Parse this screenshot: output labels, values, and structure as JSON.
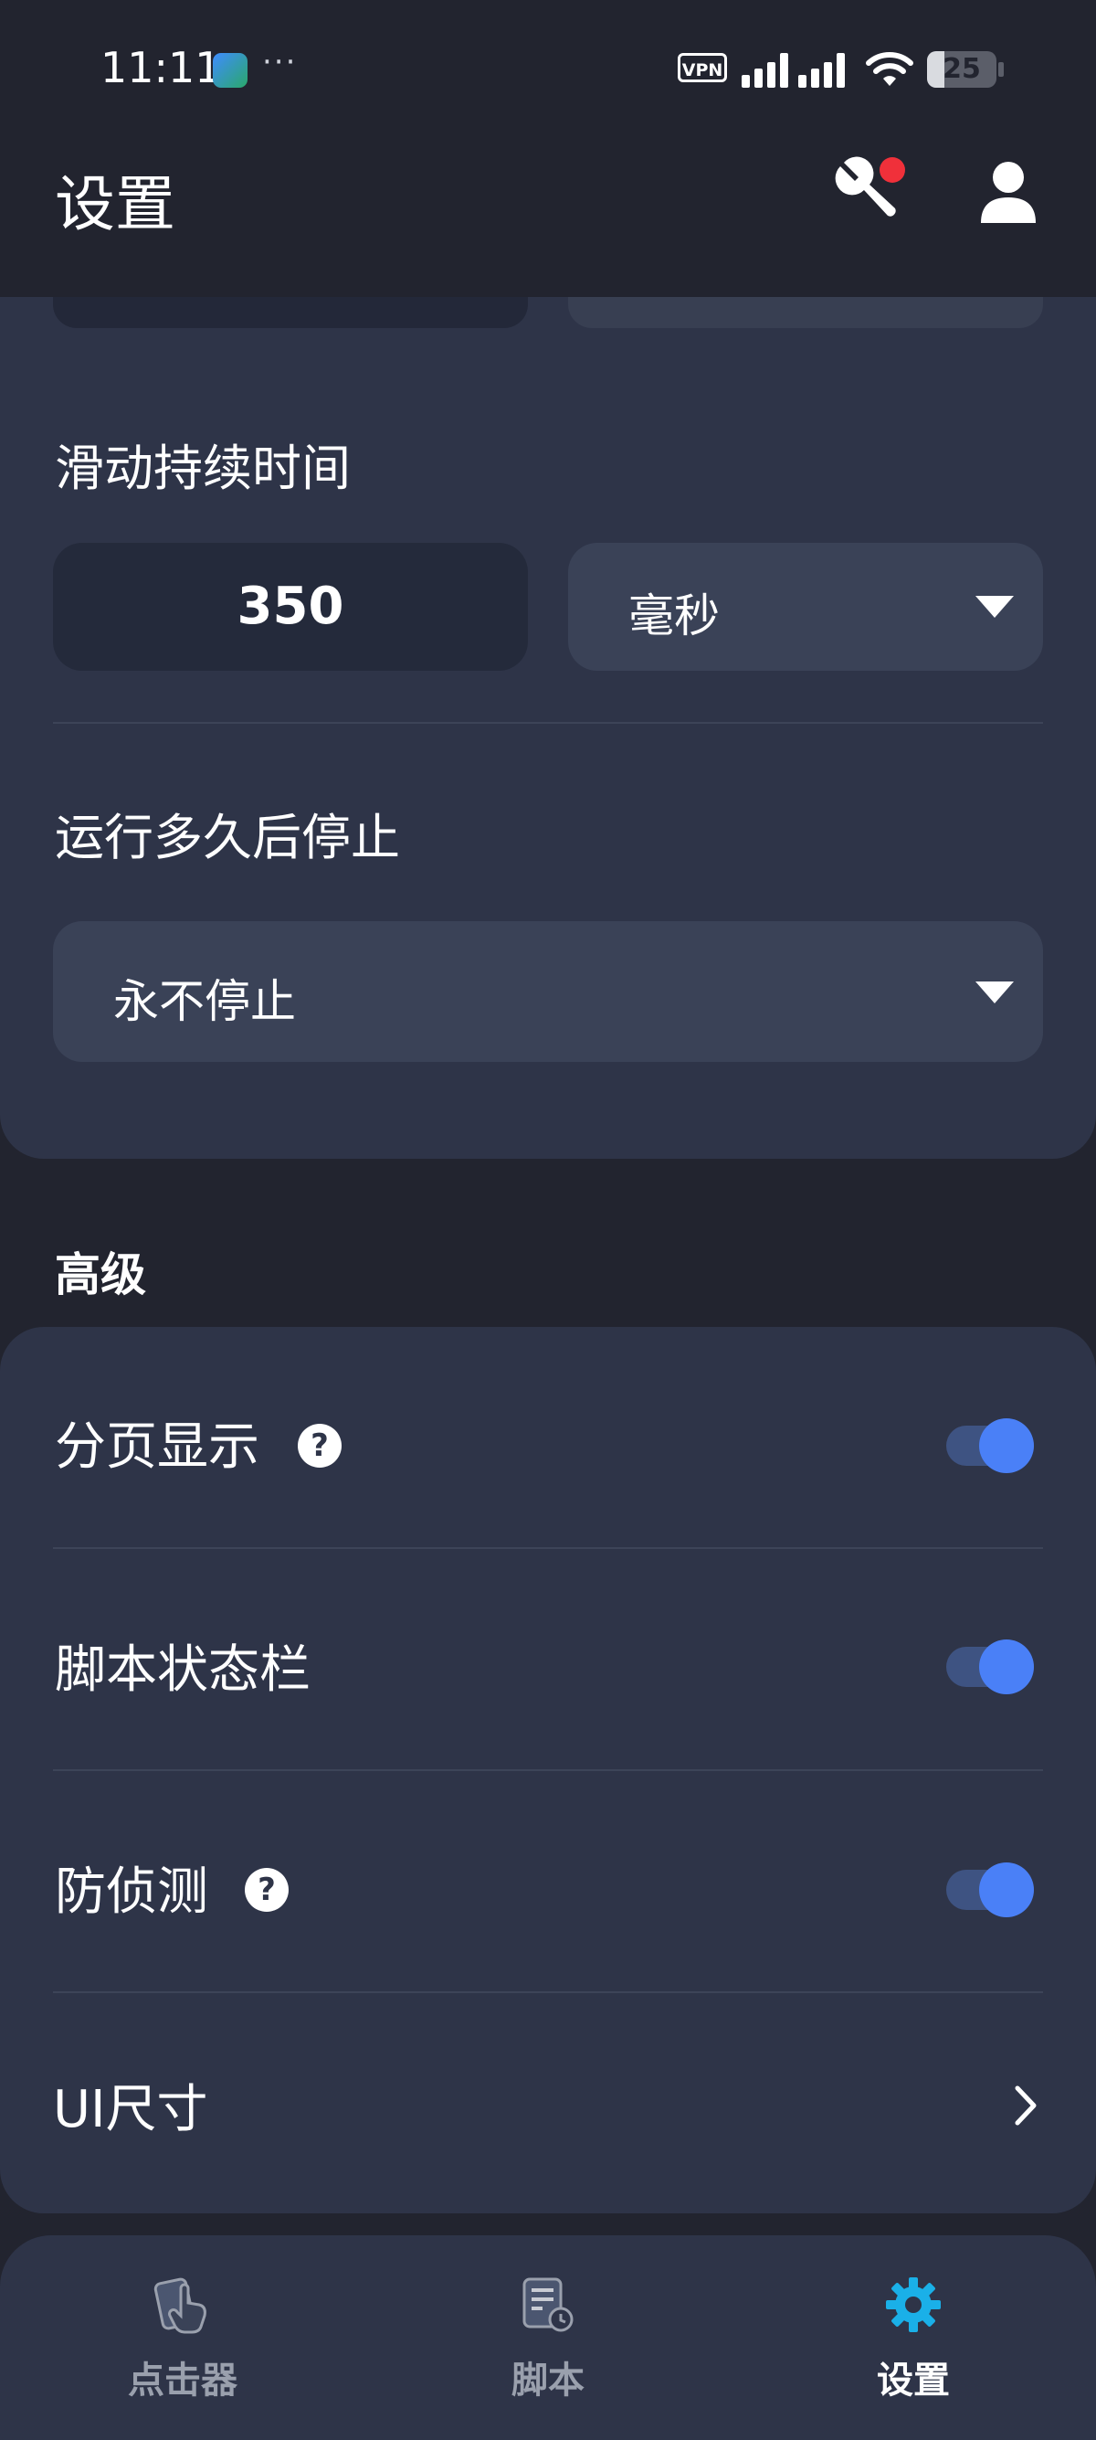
{
  "status_bar": {
    "time": "11:11",
    "more": "···",
    "vpn": "VPN",
    "battery": "25",
    "battery_level": 0.25
  },
  "header": {
    "title": "设置"
  },
  "swipe_duration": {
    "label": "滑动持续时间",
    "value": "350",
    "unit": "毫秒"
  },
  "stop_after": {
    "label": "运行多久后停止",
    "value": "永不停止"
  },
  "advanced": {
    "section_title": "高级",
    "paging": {
      "label": "分页显示",
      "help": "?",
      "enabled": true
    },
    "script_status_bar": {
      "label": "脚本状态栏",
      "enabled": true
    },
    "anti_detect": {
      "label": "防侦测",
      "help": "?",
      "enabled": true
    },
    "ui_size": {
      "label": "UI尺寸"
    }
  },
  "nav": {
    "items": [
      {
        "label": "点击器",
        "icon": "tap-hand-icon",
        "active": false
      },
      {
        "label": "脚本",
        "icon": "script-doc-icon",
        "active": false
      },
      {
        "label": "设置",
        "icon": "gear-icon",
        "active": true
      }
    ],
    "colors": {
      "active": "#1ab0e8",
      "inactive": "#9aa0ad"
    }
  },
  "colors": {
    "background": "#22242f",
    "card": "#2e3448",
    "accent": "#4a80f7",
    "badge": "#f0303a"
  }
}
